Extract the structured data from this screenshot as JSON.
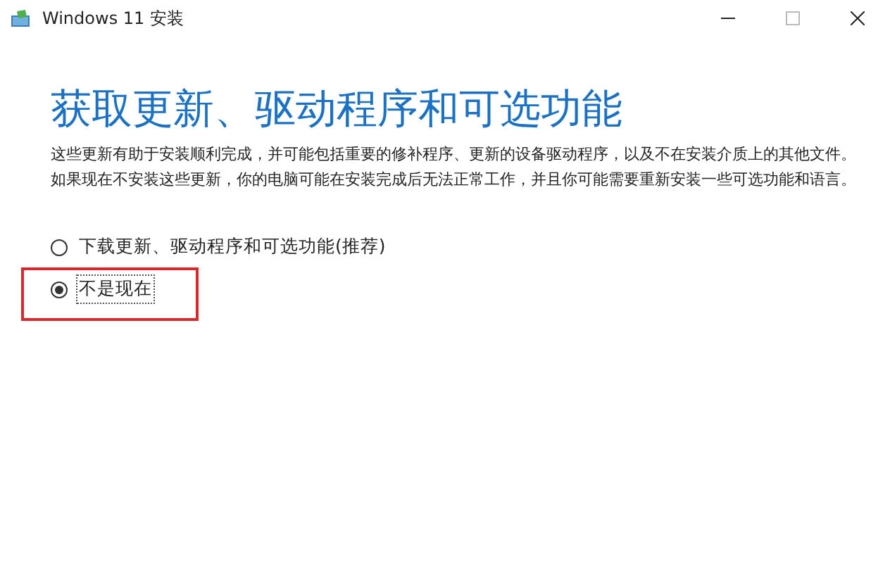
{
  "window": {
    "title": "Windows 11 安装"
  },
  "heading": "获取更新、驱动程序和可选功能",
  "description": "这些更新有助于安装顺利完成，并可能包括重要的修补程序、更新的设备驱动程序，以及不在安装介质上的其他文件。如果现在不安装这些更新，你的电脑可能在安装完成后无法正常工作，并且你可能需要重新安装一些可选功能和语言。",
  "options": [
    {
      "label": "下载更新、驱动程序和可选功能(推荐)",
      "selected": false,
      "highlighted": false
    },
    {
      "label": "不是现在",
      "selected": true,
      "highlighted": true
    }
  ]
}
